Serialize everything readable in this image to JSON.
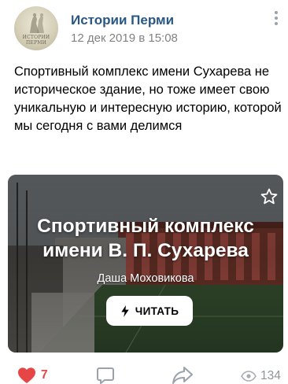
{
  "header": {
    "group_name": "Истории Перми",
    "date": "12 дек 2019 в 15:08",
    "avatar_text": "ИСТОРИИ ПЕРМИ"
  },
  "post": {
    "text": "Спортивный комплекс имени Сухарева не историческое здание, но тоже имеет свою уникальную и интересную историю, которой мы сегодня с вами делимся"
  },
  "article_card": {
    "title": "Спортивный комплекс имени В. П. Сухарева",
    "author": "Даша Моховикова",
    "read_label": "ЧИТАТЬ"
  },
  "footer": {
    "likes": "7",
    "views": "134"
  },
  "colors": {
    "link": "#2a5885",
    "like": "#e64646",
    "muted": "#828282",
    "icon": "#99a2ad"
  },
  "icons": [
    "more-vertical-icon",
    "star-icon",
    "bolt-icon",
    "heart-icon",
    "comment-icon",
    "share-icon",
    "eye-icon"
  ]
}
